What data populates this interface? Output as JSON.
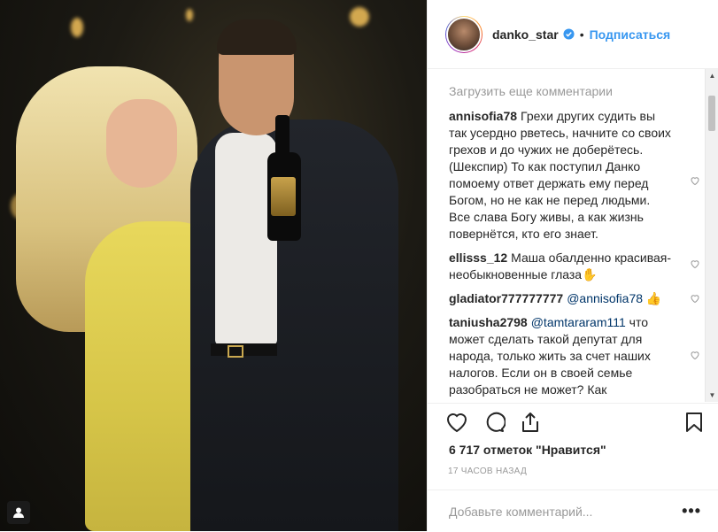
{
  "post": {
    "photo_alt": "post-photo",
    "profile_badge_icon": "person-icon"
  },
  "header": {
    "username": "danko_star",
    "separator": "•",
    "follow_label": "Подписаться",
    "verified_icon": "verified-badge-icon"
  },
  "comments": {
    "load_more": "Загрузить еще комментарии",
    "items": [
      {
        "author": "annisofia78",
        "text": "Грехи других судить вы так усердно рветесь, начните со своих грехов и до чужих не доберётесь. (Шекспир) То как поступил Данко помоему ответ держать ему перед Богом, но не как не перед людьми. Все слава Богу живы, а как жизнь повернётся, кто его знает."
      },
      {
        "author": "ellisss_12",
        "text": "Маша обалденно красивая- необыкновенные глаза✋"
      },
      {
        "author": "gladiator777777777",
        "mention": "@annisofia78",
        "text": " 👍"
      },
      {
        "author": "taniusha2798",
        "mention": "@tamtararam111",
        "text": " что может сделать такой депутат для народа, только жить за счет наших налогов. Если он в своей семье разобраться не может? Как моральные уроды туда попадают?"
      }
    ]
  },
  "actions": {
    "like_icon": "heart-icon",
    "comment_icon": "comment-icon",
    "share_icon": "share-icon",
    "save_icon": "bookmark-icon"
  },
  "likes_text": "6 717 отметок \"Нравится\"",
  "time_text": "17 ЧАСОВ НАЗАД",
  "add_comment": {
    "placeholder": "Добавьте комментарий...",
    "more_label": "•••"
  }
}
